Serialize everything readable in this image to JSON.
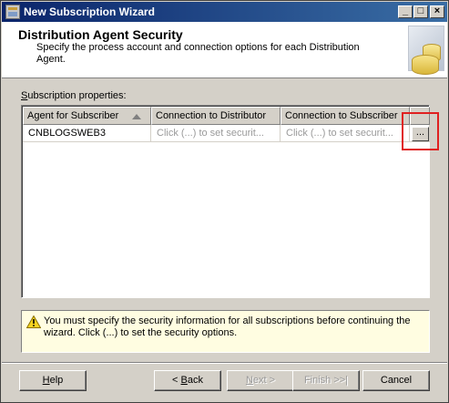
{
  "window": {
    "title": "New Subscription Wizard",
    "controls": {
      "minimize": "_",
      "maximize": "□",
      "close": "×"
    }
  },
  "header": {
    "title": "Distribution Agent Security",
    "description": "Specify the process account and connection options for each Distribution Agent."
  },
  "subscription_properties": {
    "label_accel": "S",
    "label_rest": "ubscription properties:",
    "columns": [
      "Agent for Subscriber",
      "Connection to Distributor",
      "Connection to Subscriber"
    ],
    "rows": [
      {
        "agent": "CNBLOGSWEB3",
        "distributor": "Click (...) to set securit...",
        "subscriber": "Click (...) to set securit...",
        "button": "..."
      }
    ]
  },
  "warning": {
    "icon": "warning-icon",
    "text": "You must specify the security information for all subscriptions before continuing the wizard. Click (...) to set the security options."
  },
  "buttons": {
    "help_accel": "H",
    "help_rest": "elp",
    "back_prefix": "< ",
    "back_accel": "B",
    "back_rest": "ack",
    "next_accel": "N",
    "next_rest": "ext >",
    "finish": "Finish >>|",
    "cancel": "Cancel"
  },
  "colors": {
    "title_bar": "#0a246a",
    "highlight": "#e02020",
    "warning_background": "#fffde1"
  }
}
